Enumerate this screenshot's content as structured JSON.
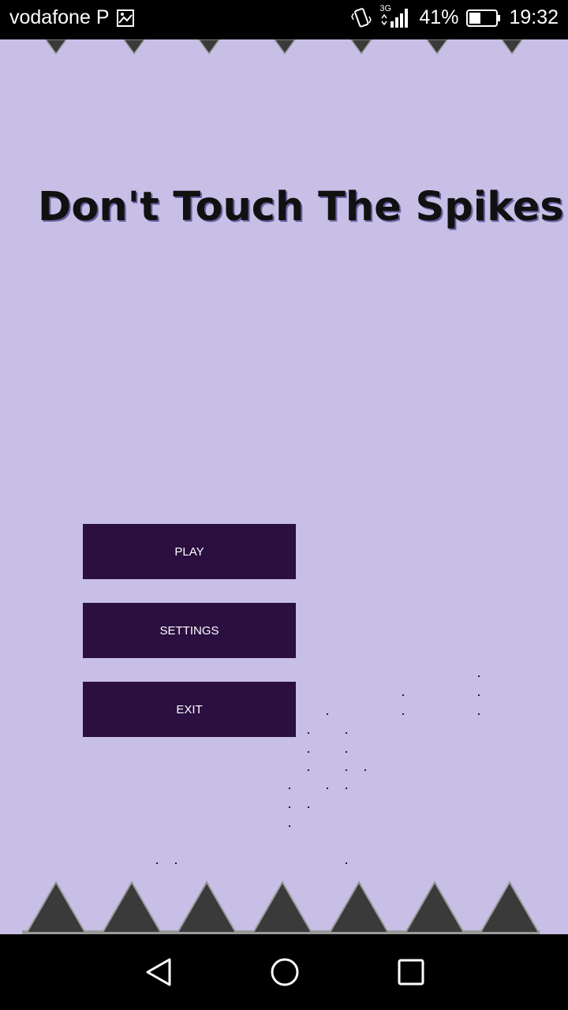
{
  "status_bar": {
    "carrier": "vodafone P",
    "network": "3G",
    "battery": "41%",
    "time": "19:32"
  },
  "game": {
    "title": "Don't Touch The Spikes",
    "buttons": {
      "play": "PLAY",
      "settings": "SETTINGS",
      "exit": "EXIT"
    }
  },
  "colors": {
    "background": "#c8bfe7",
    "button": "#2a0f40",
    "spike": "#3a3a3a"
  },
  "icons": {
    "status": [
      "image-icon",
      "vibrate-icon",
      "signal-icon",
      "battery-icon"
    ],
    "nav": [
      "back-icon",
      "home-icon",
      "recents-icon"
    ]
  }
}
